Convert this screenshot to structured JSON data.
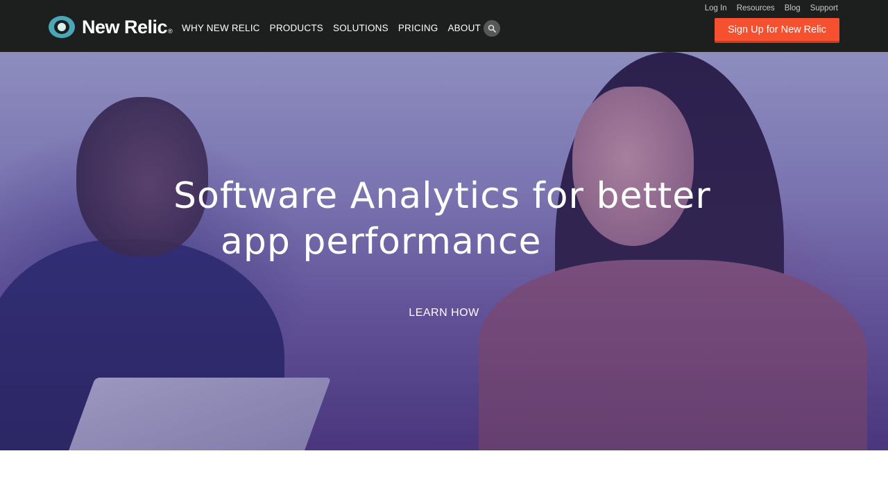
{
  "brand": {
    "name": "New Relic",
    "registered_mark": "®",
    "colors": {
      "header_bg": "#1d1e1e",
      "accent": "#f5502f",
      "logo_teal": "#49a8b8"
    }
  },
  "utility_nav": [
    {
      "label": "Log In"
    },
    {
      "label": "Resources"
    },
    {
      "label": "Blog"
    },
    {
      "label": "Support"
    }
  ],
  "main_nav": [
    {
      "label": "WHY NEW RELIC"
    },
    {
      "label": "PRODUCTS"
    },
    {
      "label": "SOLUTIONS"
    },
    {
      "label": "PRICING"
    },
    {
      "label": "ABOUT"
    }
  ],
  "search": {
    "icon": "search-icon"
  },
  "cta": {
    "signup_label": "Sign Up for New Relic"
  },
  "hero": {
    "title_line1": "Software Analytics for better",
    "title_line2": "app performance",
    "link_label": "LEARN HOW"
  }
}
